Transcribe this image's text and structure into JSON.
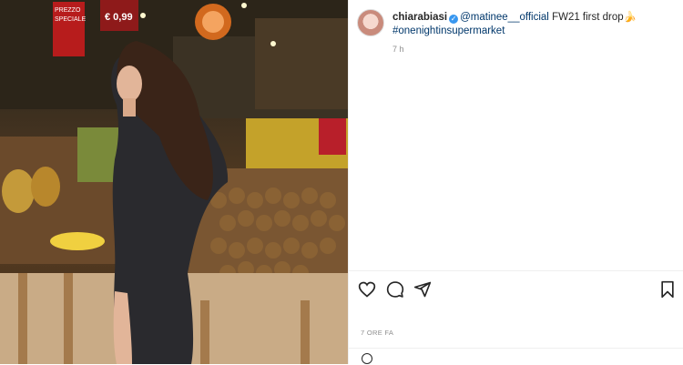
{
  "post": {
    "username": "chiarabiasi",
    "mention": "@matinee__official",
    "caption_text": " FW21 first drop",
    "caption_emoji": "🍌",
    "hashtag": "#onenightinsupermarket",
    "time_ago": "7 h",
    "date_label": "7 ORE FA"
  },
  "photo": {
    "sign_label_1": "PREZZO",
    "sign_label_2": "SPECIALE",
    "price_tag": "€ 0,99"
  },
  "icons": {
    "like": "heart-icon",
    "comment": "comment-icon",
    "share": "share-icon",
    "save": "bookmark-icon"
  }
}
